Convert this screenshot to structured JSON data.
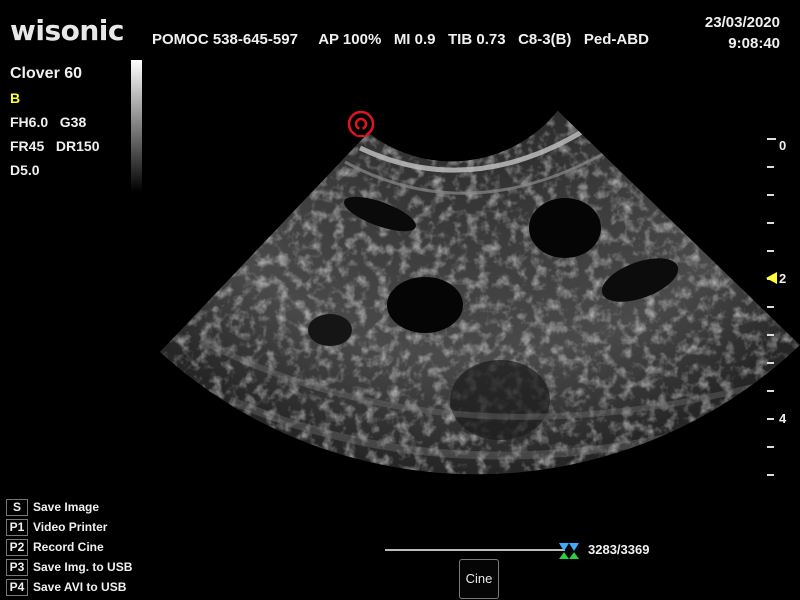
{
  "brand": "wisonic",
  "header": {
    "patient": "POMOC 538-645-597",
    "ap": "AP 100%",
    "mi": "MI 0.9",
    "tib": "TIB 0.73",
    "probe": "C8-3(B)",
    "preset": "Ped-ABD"
  },
  "datetime": {
    "date": "23/03/2020",
    "time": "9:08:40"
  },
  "params": {
    "model": "Clover 60",
    "mode": "B",
    "fh": "FH6.0",
    "gain": "G38",
    "fr": "FR45",
    "dr": "DR150",
    "depth": "D5.0"
  },
  "depth_scale": {
    "labels": [
      "0",
      "2",
      "4"
    ],
    "focus_depth": 2
  },
  "menu": [
    {
      "key": "S",
      "label": "Save Image"
    },
    {
      "key": "P1",
      "label": "Video Printer"
    },
    {
      "key": "P2",
      "label": "Record Cine"
    },
    {
      "key": "P3",
      "label": "Save Img. to USB"
    },
    {
      "key": "P4",
      "label": "Save AVI to USB"
    }
  ],
  "cine": {
    "frame": "3283/3369",
    "button": "Cine",
    "progress": 0.974
  },
  "colors": {
    "mode_yellow": "#ffff3a",
    "probe_red": "#e0141e"
  },
  "icons": [
    "probe-orientation-icon",
    "cine-position-icon",
    "focus-marker-icon"
  ]
}
